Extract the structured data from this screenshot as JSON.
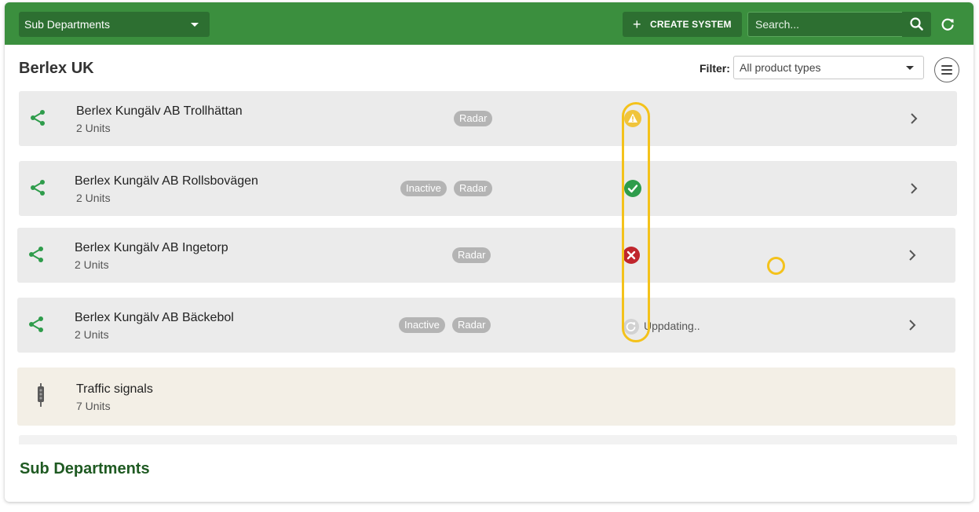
{
  "header": {
    "department_select": "Sub Departments",
    "create_button": "CREATE SYSTEM",
    "search_placeholder": "Search..."
  },
  "page": {
    "title": "Berlex UK",
    "filter_label": "Filter:",
    "filter_value": "All product types"
  },
  "systems": [
    {
      "name": "Berlex Kungälv AB Trollhättan",
      "units": "2 Units",
      "badges": [
        "Radar"
      ],
      "status": "warning"
    },
    {
      "name": "Berlex Kungälv AB Rollsbovägen",
      "units": "2 Units",
      "badges": [
        "Inactive",
        "Radar"
      ],
      "status": "ok"
    },
    {
      "name": "Berlex Kungälv AB Ingetorp",
      "units": "2 Units",
      "badges": [
        "Radar"
      ],
      "status": "error"
    },
    {
      "name": "Berlex Kungälv AB Bäckebol",
      "units": "2 Units",
      "badges": [
        "Inactive",
        "Radar"
      ],
      "status": "updating",
      "status_text": "Uppdating.."
    }
  ],
  "traffic": {
    "name": "Traffic signals",
    "units": "7 Units"
  },
  "section_title": "Sub Departments",
  "icons": {
    "network": "share-nodes-icon",
    "traffic": "traffic-light-icon",
    "warning": "warning-icon",
    "ok": "check-circle-icon",
    "error": "error-circle-icon",
    "updating": "sync-icon",
    "chevron": "chevron-right-icon",
    "search": "search-icon",
    "refresh": "refresh-icon",
    "menu": "menu-icon"
  },
  "colors": {
    "header_green": "#3b8f3e",
    "dark_green": "#2d6f31",
    "warning": "#f0c43b",
    "ok": "#2e9c4b",
    "error": "#c0262d",
    "highlight": "#f4c21b"
  }
}
